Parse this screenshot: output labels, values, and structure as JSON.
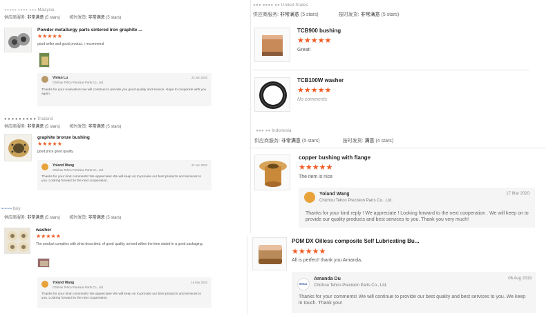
{
  "left": {
    "reviews": [
      {
        "country": "Malaysia",
        "supplier_label": "供应商服务:",
        "supplier_value": "非常满意",
        "supplier_stars": "(5 stars)",
        "ontime_label": "按时发货:",
        "ontime_value": "非常满意",
        "ontime_stars": "(5 stars)",
        "product": "Powder metallurgy parts sintered iron graphite ...",
        "stars": "★★★★★",
        "text": "good seller and good product. i recommend",
        "reply_name": "Vivian Lu",
        "reply_company": "Chizhou Tehco Precision Parts Co., Ltd.",
        "reply_date": "23 Jun 2020",
        "reply_text": "Thanks for your evaluation! we will continue to provide you good quality and service. Hope to cooperate with you again."
      },
      {
        "country": "Thailand",
        "supplier_label": "供应商服务:",
        "supplier_value": "非常满意",
        "supplier_stars": "(5 stars)",
        "ontime_label": "按时发货:",
        "ontime_value": "非常满意",
        "ontime_stars": "(5 stars)",
        "product": "graphite bronze bushing",
        "stars": "★★★★★",
        "text": "good price good quality",
        "reply_name": "Yoland Wang",
        "reply_company": "Chizhou Tehco Precision Parts Co., Ltd.",
        "reply_date": "22 Jun 2020",
        "reply_text": "Thanks for your kind comments! We appreciate! We will keep on to provide our best products and services to you. Looking forward to the next cooperation."
      },
      {
        "country": "Italy",
        "supplier_label": "供应商服务:",
        "supplier_value": "非常满意",
        "supplier_stars": "(5 stars)",
        "ontime_label": "按时发货:",
        "ontime_value": "非常满意",
        "ontime_stars": "(5 stars)",
        "product": "washer",
        "stars": "★★★★★",
        "text": "The product complies with what described, of good quality, arrived within the time stated in a good packaging.",
        "reply_name": "Yoland Wang",
        "reply_company": "Chizhou Tehco Precision Parts Co., Ltd.",
        "reply_date": "19 Mar 2020",
        "reply_text": "Thanks for your kind comments! We appreciate! We will keep on to provide our best products and services to you. Looking forward to the next cooperation."
      }
    ]
  },
  "right": {
    "top": {
      "country": "United States",
      "supplier_label": "供应商服务:",
      "supplier_value": "非常满意",
      "supplier_stars": "(5 stars)",
      "ontime_label": "按时发货:",
      "ontime_value": "非常满意",
      "ontime_stars": "(5 stars)",
      "items": [
        {
          "product": "TCB900 bushing",
          "stars": "★★★★★",
          "text": "Great!"
        },
        {
          "product": "TCB100W washer",
          "stars": "★★★★★",
          "text": "No comments"
        }
      ]
    },
    "middle": {
      "country": "Indonesia",
      "supplier_label": "供应商服务:",
      "supplier_value": "非常满意",
      "supplier_stars": "(5 stars)",
      "ontime_label": "按时发货:",
      "ontime_value": "满意",
      "ontime_stars": "(4 stars)",
      "product": "copper bushing with flange",
      "stars": "★★★★★",
      "text": "The item is nice",
      "reply_name": "Yoland Wang",
      "reply_company": "Chizhou Tehco Precision Parts Co., Ltd.",
      "reply_date": "17 Mar 2020",
      "reply_text": "Thanks for your kind reply ! We appreciate ! Looking forward to the next cooperation . We will keep on to provide our quality products and best services to you. Thank you very much!"
    },
    "bottom": {
      "product": "POM DX Oilless composite Self Lubricating Bu...",
      "stars": "★★★★★",
      "text": "All is perfect! thank you Amanda,",
      "reply_name": "Amanda Du",
      "reply_company": "Chizhou Tehco Precision Parts Co., Ltd.",
      "reply_date": "06 Aug 2019",
      "reply_text": "Thanks for your comments! We will continue to provide our best quality and best services to you. We keep in touch. Thank you!",
      "avatar_logo": "TEHCO"
    }
  },
  "colors": {
    "star": "#f05a22",
    "reply_bg": "#f5f5f5",
    "avatar": "#e8a23a"
  }
}
